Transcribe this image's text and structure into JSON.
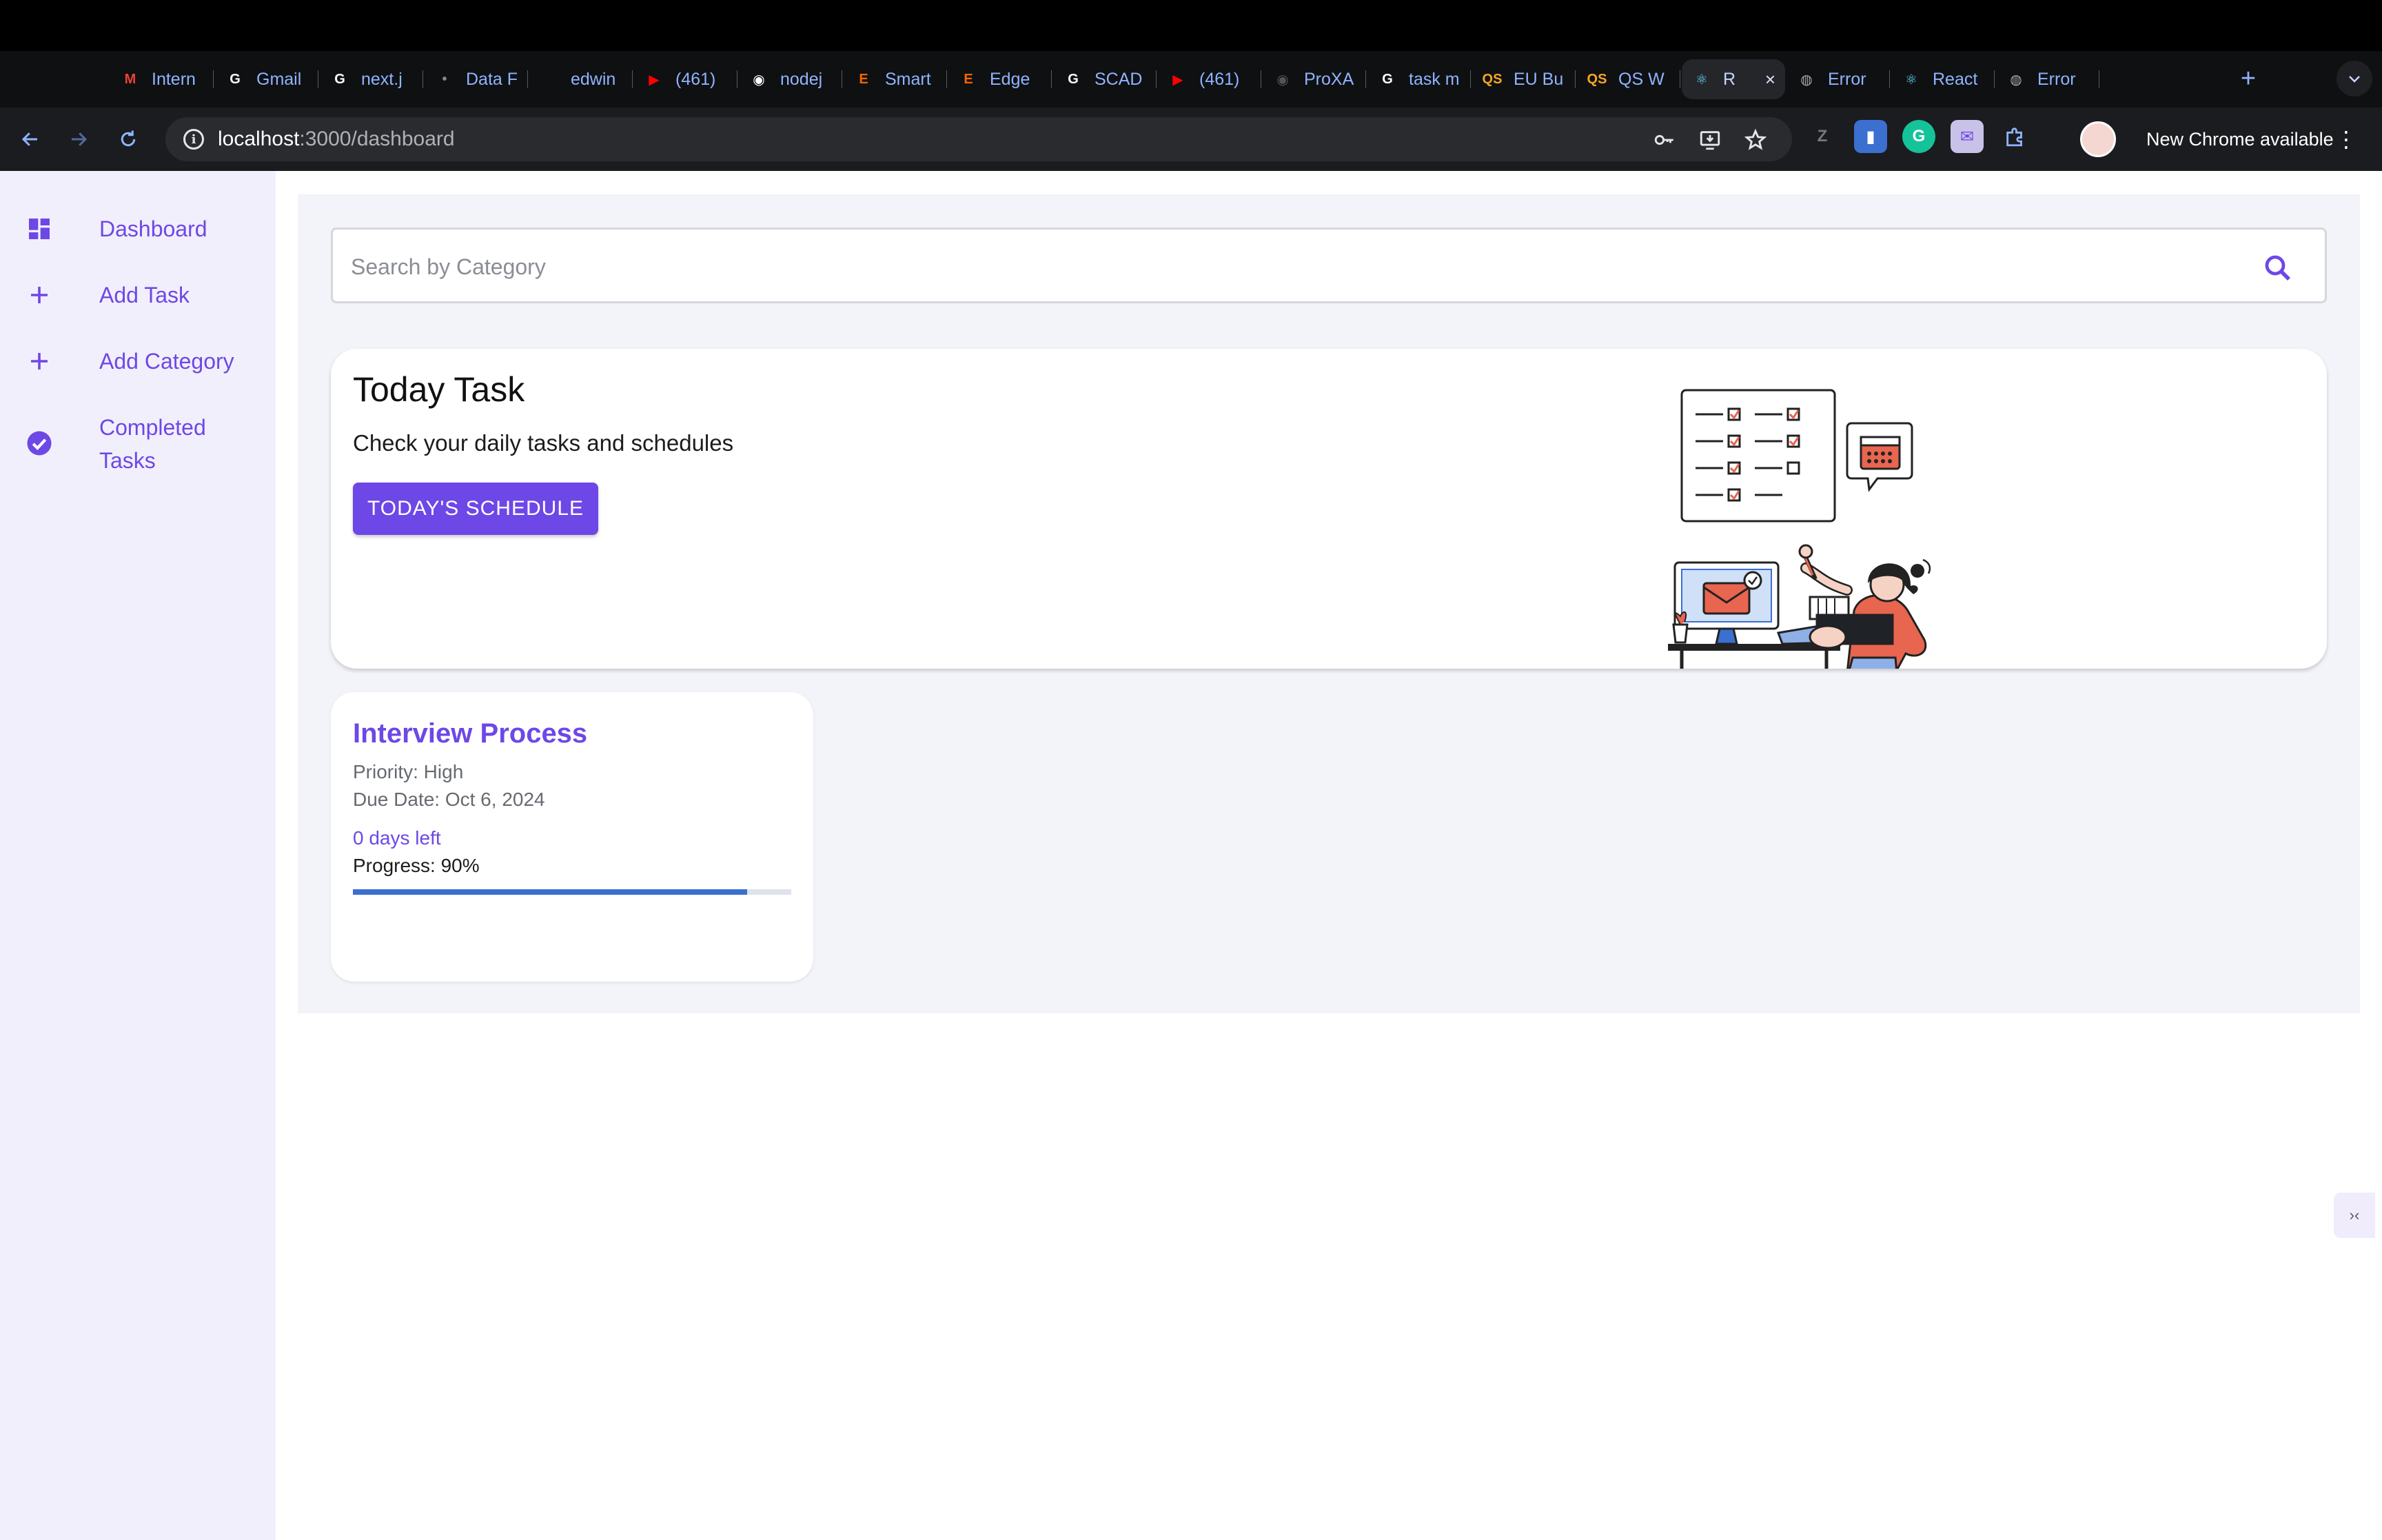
{
  "browser": {
    "tabs": [
      {
        "label": "Intern",
        "icon": "gmail-icon",
        "color": "#ea4335",
        "glyph": "M"
      },
      {
        "label": "Gmail",
        "icon": "google-icon",
        "color": "#ffffff",
        "glyph": "G"
      },
      {
        "label": "next.j",
        "icon": "google-icon",
        "color": "#ffffff",
        "glyph": "G"
      },
      {
        "label": "Data F",
        "icon": "dot-icon",
        "color": "#888888",
        "glyph": "•"
      },
      {
        "label": "edwin",
        "icon": "page-icon",
        "color": "#333333",
        "glyph": ""
      },
      {
        "label": "(461)",
        "icon": "youtube-icon",
        "color": "#ff0000",
        "glyph": "▶"
      },
      {
        "label": "nodej",
        "icon": "github-icon",
        "color": "#ffffff",
        "glyph": "◉"
      },
      {
        "label": "Smart",
        "icon": "etsy-icon",
        "color": "#f56400",
        "glyph": "E"
      },
      {
        "label": "Edge",
        "icon": "etsy-icon",
        "color": "#f56400",
        "glyph": "E"
      },
      {
        "label": "SCAD",
        "icon": "google-icon",
        "color": "#ffffff",
        "glyph": "G"
      },
      {
        "label": "(461)",
        "icon": "youtube-icon",
        "color": "#ff0000",
        "glyph": "▶"
      },
      {
        "label": "ProXA",
        "icon": "github-icon",
        "color": "#555555",
        "glyph": "◉"
      },
      {
        "label": "task m",
        "icon": "google-icon",
        "color": "#ffffff",
        "glyph": "G"
      },
      {
        "label": "EU Bu",
        "icon": "qs-icon",
        "color": "#f5a623",
        "glyph": "QS"
      },
      {
        "label": "QS W",
        "icon": "qs-icon",
        "color": "#f5a623",
        "glyph": "QS"
      },
      {
        "label": "R",
        "icon": "react-icon",
        "color": "#61dafb",
        "glyph": "⚛",
        "active": true
      },
      {
        "label": "Error",
        "icon": "globe-icon",
        "color": "#aaaaaa",
        "glyph": "◍"
      },
      {
        "label": "React",
        "icon": "react-icon",
        "color": "#61dafb",
        "glyph": "⚛"
      },
      {
        "label": "Error",
        "icon": "globe-icon",
        "color": "#aaaaaa",
        "glyph": "◍"
      }
    ],
    "new_tab": "+",
    "url_host": "localhost",
    "url_path": ":3000/dashboard",
    "update_label": "New Chrome available"
  },
  "sidebar": {
    "items": [
      {
        "label": "Dashboard",
        "icon": "dashboard-icon"
      },
      {
        "label": "Add Task",
        "icon": "plus-icon"
      },
      {
        "label": "Add Category",
        "icon": "plus-icon"
      },
      {
        "label": "Completed Tasks",
        "icon": "check-circle-icon"
      }
    ]
  },
  "search": {
    "placeholder": "Search by Category",
    "value": ""
  },
  "today": {
    "title": "Today Task",
    "subtitle": "Check your daily tasks and schedules",
    "button": "TODAY'S SCHEDULE"
  },
  "tasks": [
    {
      "title": "Interview Process",
      "priority": "Priority: High",
      "due": "Due Date: Oct 6, 2024",
      "days_left": "0 days left",
      "progress_label": "Progress: 90%",
      "progress": 0.9
    }
  ],
  "colors": {
    "accent": "#6d48e6",
    "progress": "#3b6fd0",
    "illustration_accent": "#e8654f"
  }
}
